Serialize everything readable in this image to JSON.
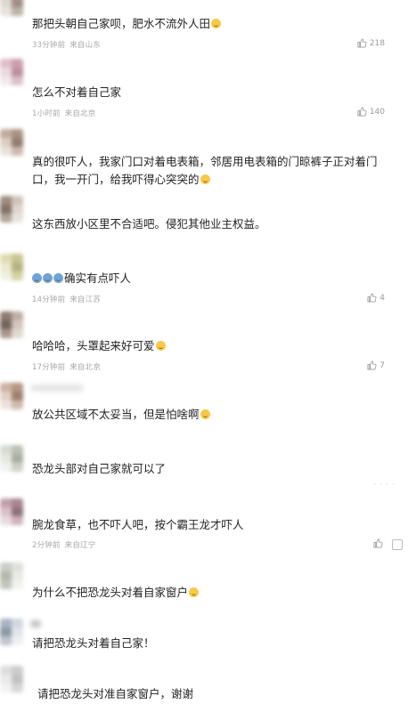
{
  "comments": [
    {
      "text": "那把头朝自己家呗，肥水不流外人田",
      "emoji": "grin",
      "time": "33分钟前",
      "source": "来自山东",
      "likes": "218"
    },
    {
      "text": "怎么不对着自己家",
      "emoji": "",
      "time": "1小时前",
      "source": "来自北京",
      "likes": "140"
    },
    {
      "text": "真的很吓人，我家门口对着电表箱，邻居用电表箱的门晾裤子正对着门口，我一开门，给我吓得心突突的",
      "emoji": "grin",
      "time": "",
      "source": "",
      "likes": ""
    },
    {
      "text": "这东西放小区里不合适吧。侵犯其他业主权益。",
      "emoji": "",
      "time": "",
      "source": "",
      "likes": ""
    },
    {
      "text": "确实有点吓人",
      "emoji": "blue3",
      "time": "14分钟前",
      "source": "来自江苏",
      "likes": "4"
    },
    {
      "text": "哈哈哈，头罩起来好可爱",
      "emoji": "grin",
      "time": "17分钟前",
      "source": "来自北京",
      "likes": "7"
    },
    {
      "text": "放公共区域不太妥当，但是怕啥啊",
      "emoji": "grin",
      "time": "",
      "source": "",
      "likes": ""
    },
    {
      "text": "恐龙头部对自己家就可以了",
      "emoji": "",
      "time": "",
      "source": "",
      "likes": ""
    },
    {
      "text": "腕龙食草，也不吓人吧，按个霸王龙才吓人",
      "emoji": "",
      "time": "2分钟前",
      "source": "来自辽宁",
      "likes": ""
    },
    {
      "text": "为什么不把恐龙头对着自家窗户",
      "emoji": "smile",
      "time": "",
      "source": "",
      "likes": ""
    },
    {
      "text": "请把恐龙头对着自己家！",
      "emoji": "",
      "time": "",
      "source": "",
      "likes": ""
    },
    {
      "text": "请把恐龙头对准自家窗户，谢谢",
      "emoji": "",
      "time": "",
      "source": "",
      "likes": ""
    }
  ],
  "colors": {
    "text": "#1f1f1f",
    "meta": "#a8a8a8",
    "emoji": "#f7c948"
  }
}
